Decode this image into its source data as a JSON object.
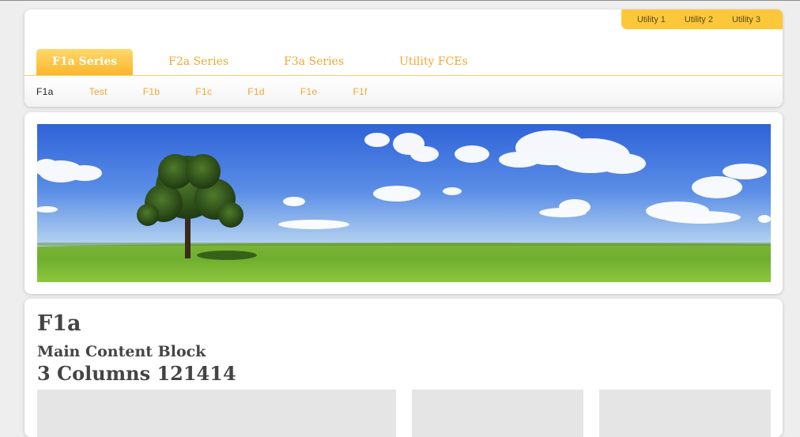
{
  "utility_nav": {
    "items": [
      {
        "label": "Utility 1"
      },
      {
        "label": "Utility 2"
      },
      {
        "label": "Utility 3"
      }
    ]
  },
  "primary_nav": {
    "tabs": [
      {
        "label": "F1a Series",
        "active": true
      },
      {
        "label": "F2a Series",
        "active": false
      },
      {
        "label": "F3a Series",
        "active": false
      },
      {
        "label": "Utility FCEs",
        "active": false
      }
    ]
  },
  "sub_nav": {
    "items": [
      {
        "label": "F1a",
        "current": true
      },
      {
        "label": "Test",
        "current": false
      },
      {
        "label": "F1b",
        "current": false
      },
      {
        "label": "F1c",
        "current": false
      },
      {
        "label": "F1d",
        "current": false
      },
      {
        "label": "F1e",
        "current": false
      },
      {
        "label": "F1f",
        "current": false
      }
    ]
  },
  "banner": {
    "image": "tree-in-green-field-under-blue-sky"
  },
  "main": {
    "title": "F1a",
    "subtitle": "Main Content Block",
    "columns_heading": "3 Columns 121414"
  },
  "colors": {
    "accent": "#fcc83a",
    "link": "#f0a832",
    "heading": "#444444",
    "column_placeholder": "#e5e5e5"
  }
}
